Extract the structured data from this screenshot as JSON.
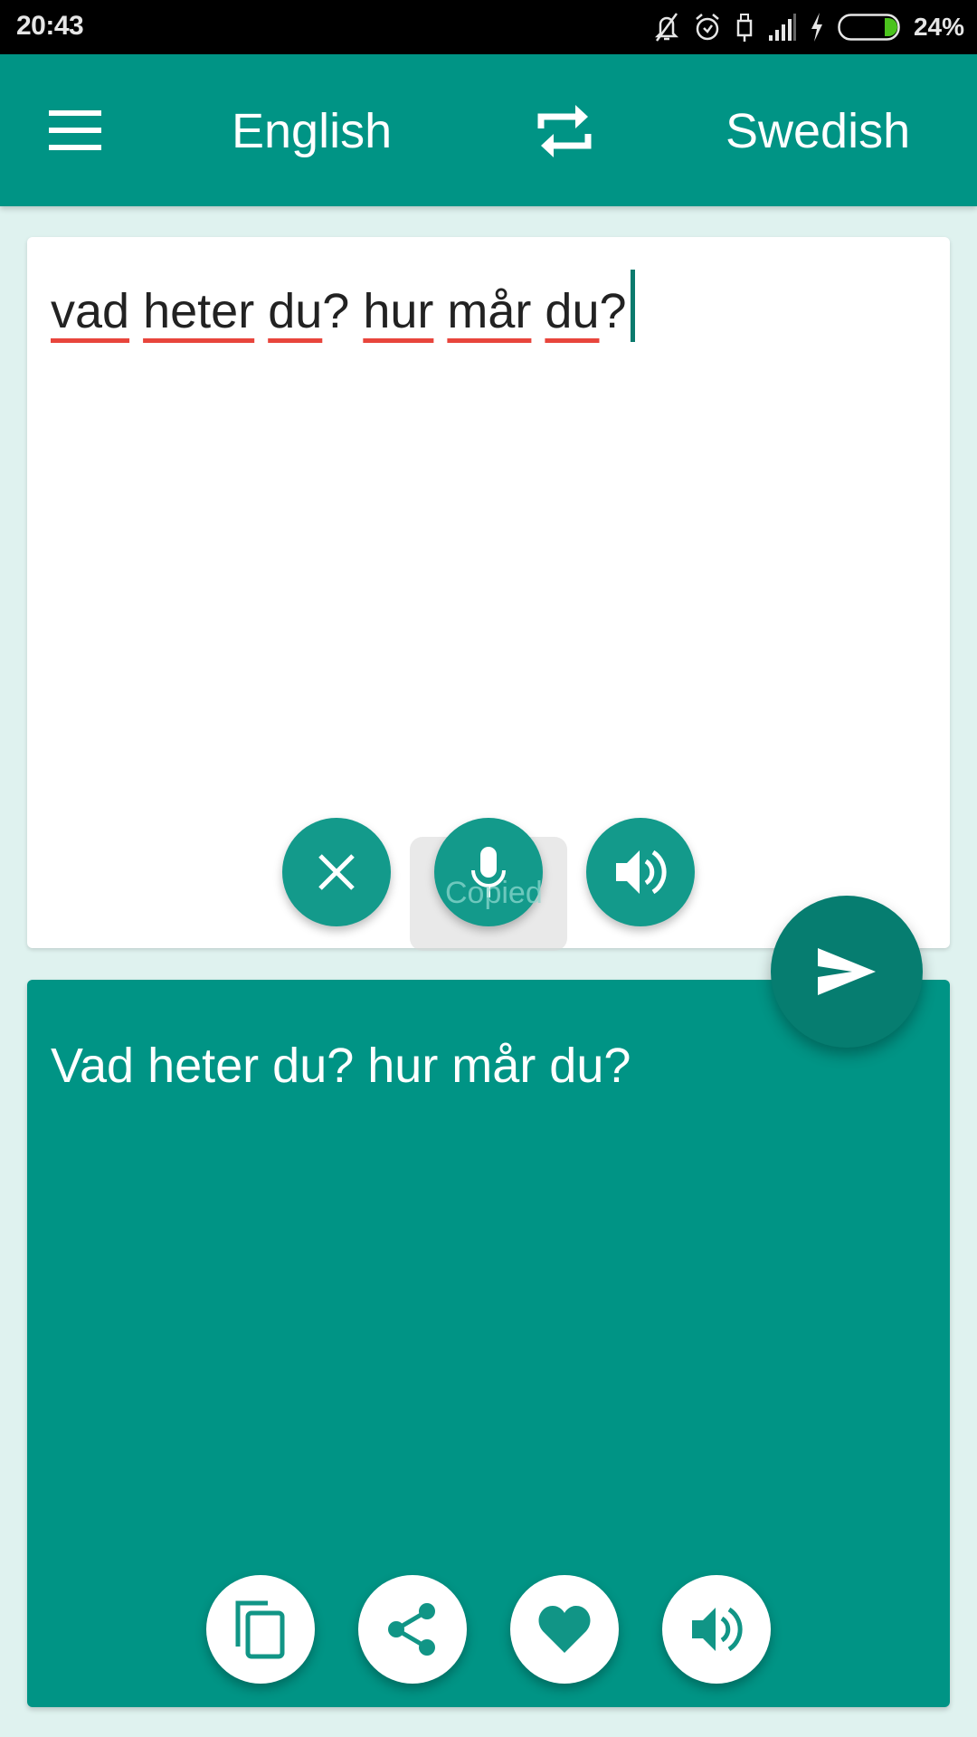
{
  "status_bar": {
    "time": "20:43",
    "icons": [
      "notifications-off-icon",
      "alarm-icon",
      "usb-icon",
      "signal-icon",
      "charging-icon",
      "battery-icon"
    ],
    "battery_percent": "24%",
    "battery_level": 0.24
  },
  "app_bar": {
    "menu_icon": "menu-icon",
    "source_language": "English",
    "swap_icon": "swap-languages-icon",
    "target_language": "Swedish"
  },
  "input": {
    "words": [
      "vad",
      "heter",
      "du",
      "hur",
      "mår",
      "du"
    ],
    "text": "vad heter du? hur mår du?",
    "misspelled_underline_color": "#e8453c",
    "actions": [
      {
        "name": "clear",
        "icon": "close-icon"
      },
      {
        "name": "voice-input",
        "icon": "microphone-icon"
      },
      {
        "name": "speak-input",
        "icon": "volume-icon"
      }
    ]
  },
  "toast": {
    "text": "Copied"
  },
  "send_button": {
    "icon": "send-icon"
  },
  "output": {
    "text": "Vad heter du? hur mår du?",
    "actions": [
      {
        "name": "copy",
        "icon": "copy-icon"
      },
      {
        "name": "share",
        "icon": "share-icon"
      },
      {
        "name": "favorite",
        "icon": "heart-icon"
      },
      {
        "name": "speak-output",
        "icon": "volume-icon"
      }
    ]
  },
  "colors": {
    "primary": "#009485",
    "primary_dark": "#067d70",
    "background": "#dff2ef",
    "accent_fab": "#139a8b"
  }
}
